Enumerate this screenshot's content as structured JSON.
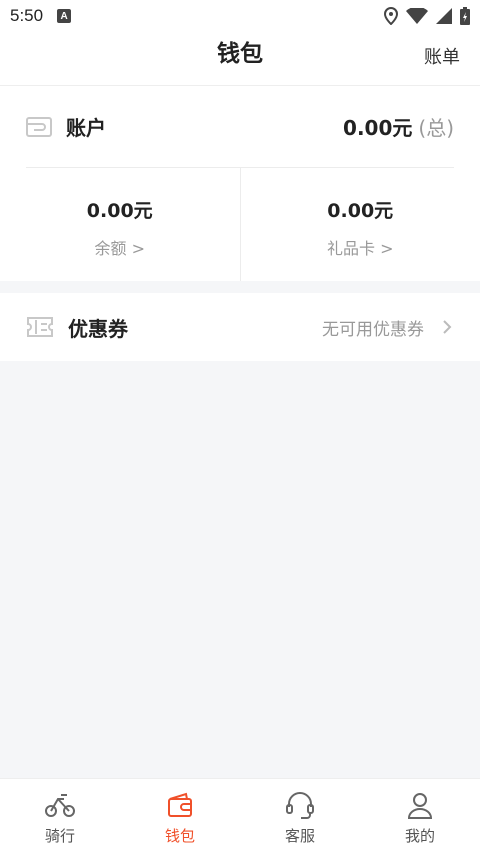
{
  "status_bar": {
    "time": "5:50",
    "notification_letter": "A"
  },
  "header": {
    "title": "钱包",
    "bill_link": "账单"
  },
  "account": {
    "label": "账户",
    "total_amount": "0.00元",
    "total_suffix": "(总)",
    "balance": {
      "amount": "0.00元",
      "label": "余额 >"
    },
    "gift_card": {
      "amount": "0.00元",
      "label": "礼品卡 >"
    }
  },
  "coupon": {
    "label": "优惠券",
    "status": "无可用优惠券"
  },
  "tabbar": {
    "active_color": "#f0502a",
    "items": [
      {
        "label": "骑行",
        "icon": "scooter-icon"
      },
      {
        "label": "钱包",
        "icon": "wallet-icon"
      },
      {
        "label": "客服",
        "icon": "headset-icon"
      },
      {
        "label": "我的",
        "icon": "user-icon"
      }
    ]
  }
}
